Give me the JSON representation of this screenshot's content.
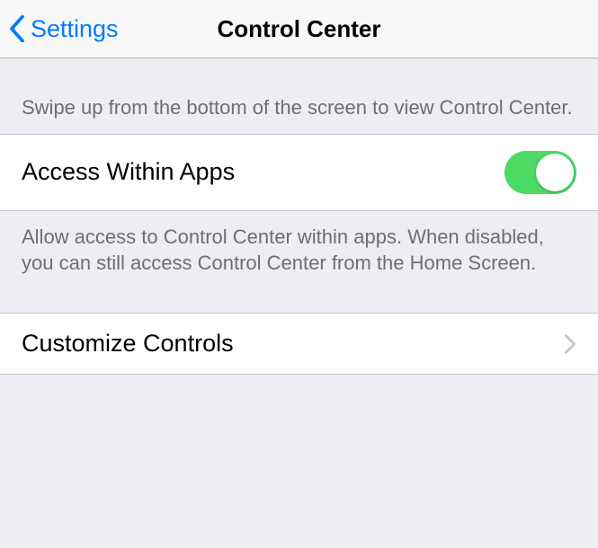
{
  "nav": {
    "back_label": "Settings",
    "title": "Control Center"
  },
  "section1": {
    "header_text": "Swipe up from the bottom of the screen to view Control Center.",
    "row_label": "Access Within Apps",
    "footer_text": "Allow access to Control Center within apps. When disabled, you can still access Control Center from the Home Screen."
  },
  "section2": {
    "row_label": "Customize Controls"
  }
}
